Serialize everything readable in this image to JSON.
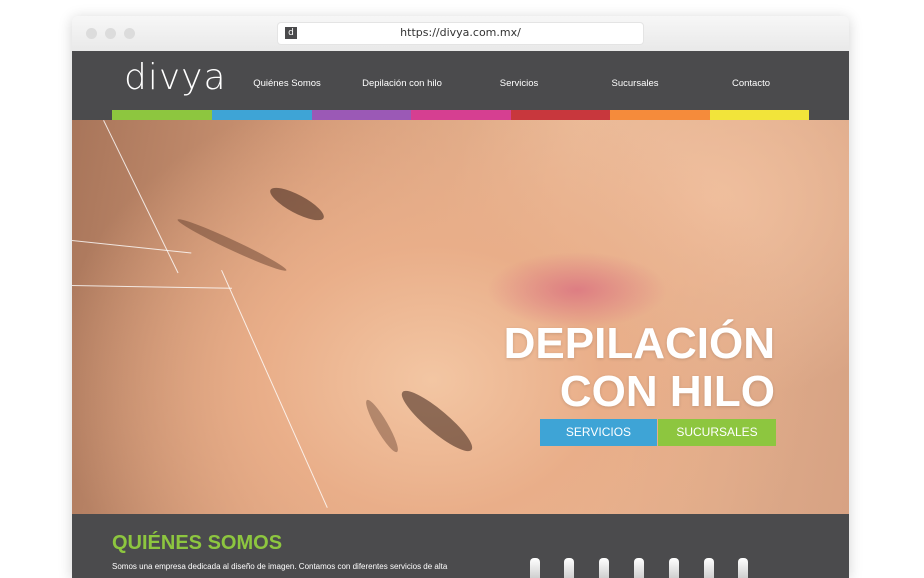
{
  "browser": {
    "url": "https://divya.com.mx/",
    "favicon": "d"
  },
  "site": {
    "logo": "divya",
    "nav": [
      "Quiénes Somos",
      "Depilación con hilo",
      "Servicios",
      "Sucursales",
      "Contacto"
    ],
    "stripe_colors": [
      "#8dc63f",
      "#3ea4d6",
      "#9b59b6",
      "#d63f91",
      "#c8373d",
      "#f58b3b",
      "#f2e43a"
    ]
  },
  "hero": {
    "title_line1": "DEPILACIÓN",
    "title_line2": "CON HILO",
    "btn_servicios": "SERVICIOS",
    "btn_sucursales": "SUCURSALES",
    "btn_servicios_color": "#3ea4d6",
    "btn_sucursales_color": "#8dc63f"
  },
  "about": {
    "title": "QUIÉNES SOMOS",
    "text": "Somos una empresa dedicada al diseño de imagen. Contamos con diferentes servicios de alta"
  }
}
